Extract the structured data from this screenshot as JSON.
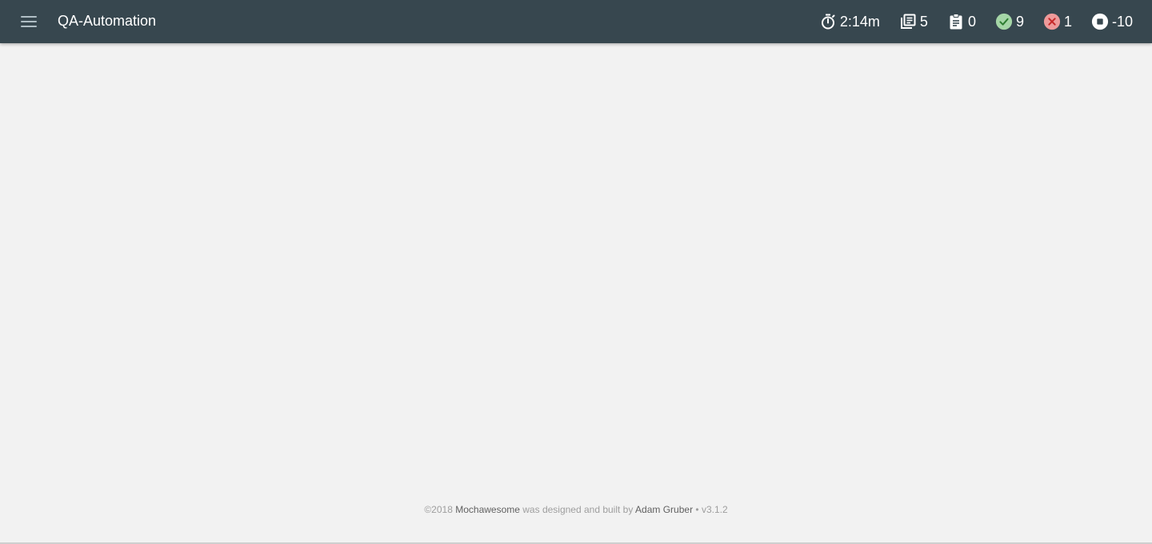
{
  "navbar": {
    "title": "QA-Automation",
    "stats": {
      "duration": "2:14m",
      "suites": "5",
      "tests": "0",
      "passed": "9",
      "failed": "1",
      "pending": "-10"
    }
  },
  "colors": {
    "navbar_bg": "#37474f",
    "page_bg": "#f2f2f2",
    "passed": "#a5d6a7",
    "passed_check": "#2e7d32",
    "failed": "#ef9a9a",
    "failed_x": "#c62828"
  },
  "footer": {
    "copyright": "©2018",
    "brand": "Mochawesome",
    "middle": "was designed and built by",
    "author": "Adam Gruber",
    "separator": "•",
    "version": "v3.1.2"
  }
}
